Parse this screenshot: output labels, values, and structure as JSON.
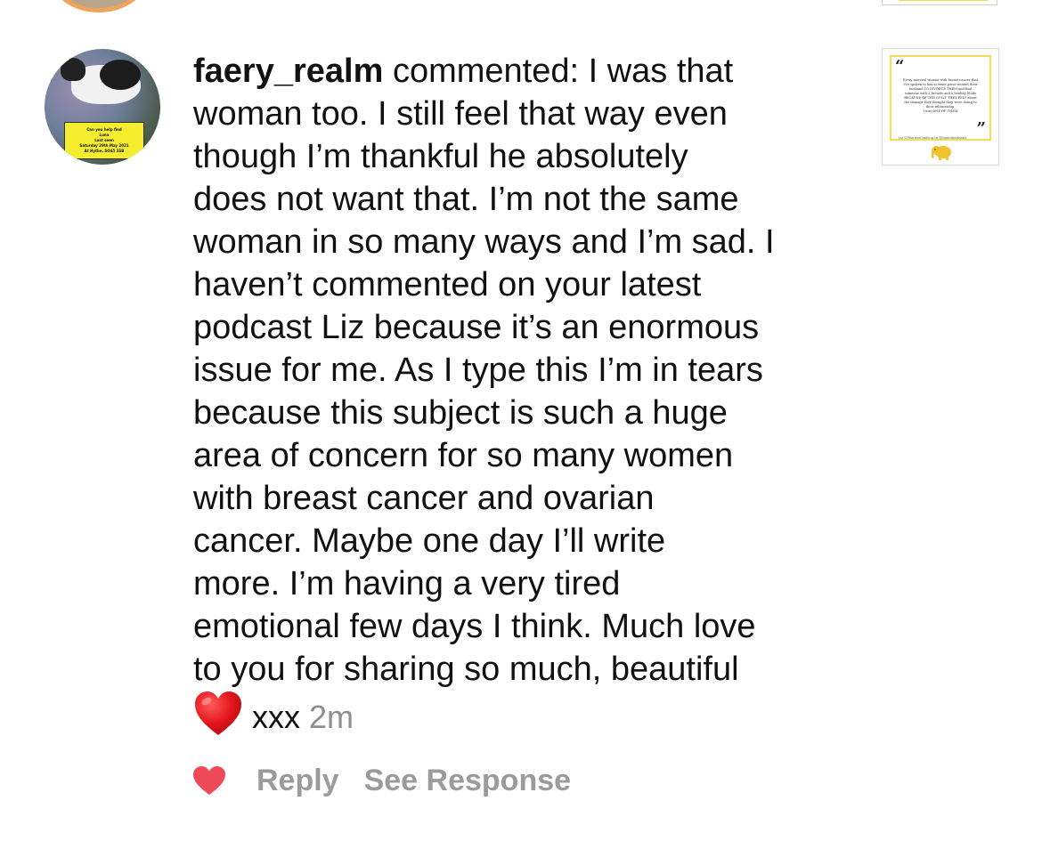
{
  "comment": {
    "username": "faery_realm",
    "verb": "commented:",
    "lines": [
      "I was that",
      "woman too. I still feel that way even",
      "though I’m thankful he absolutely",
      "does not want that. I’m not the same",
      "woman in so many ways and I’m sad. I",
      "haven’t commented on your latest",
      "podcast Liz because it’s an enormous",
      "issue for me. As I type this I’m in tears",
      "because this subject is such a huge",
      "area of concern for so many women",
      "with breast cancer and ovarian",
      "cancer.  Maybe one day I’ll write",
      "more. I’m having a very tired",
      "emotional few days I think. Much love",
      "to you for sharing so much,  beautiful"
    ],
    "emoji_icon": "red-heart-emoji",
    "sign_off": "xxx",
    "timestamp": "2m"
  },
  "avatar": {
    "poster_lines": [
      "Can you help find",
      "Luna",
      "Last seen",
      "Saturday 29th May 2021",
      "At Hythe, SO45 3SB"
    ]
  },
  "actions": {
    "like_icon": "heart-icon",
    "like_color": "#ed4956",
    "reply_label": "Reply",
    "see_response_label": "See Response"
  },
  "thumbnail": {
    "quote": "Every married woman with breast cancer that\nI've spoken to has at some point wanted their\nhusband  TO DIVORCE THEM and find\nsomeone with 2 breasts and a healthy libido\nBECAUSE OF THE GUILT THEY FELT about\nthe damage they thought they were doing to\ntheir relationship.\nI was ONE OF THEM",
    "credit": "Liz O'Riordan talking to @boombalkssex",
    "accent_color": "#f3de59",
    "icon": "elephant-icon"
  },
  "colors": {
    "text": "#111111",
    "muted": "#8e8e8e",
    "action_gray": "#9b9b9b",
    "heart": "#ed4956"
  }
}
